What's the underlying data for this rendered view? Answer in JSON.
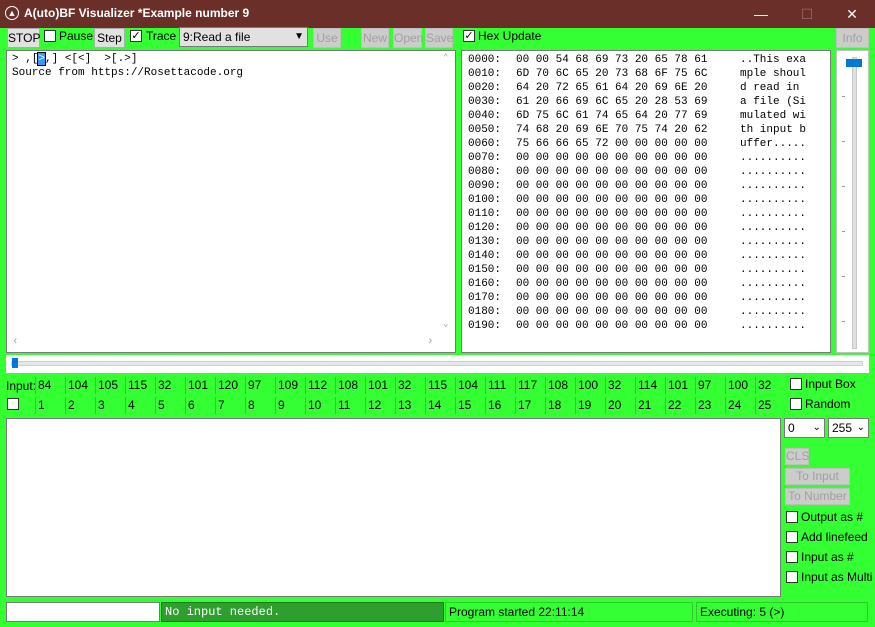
{
  "title": "A(uto)BF Visualizer *Example number 9",
  "window": {
    "minimize": "—",
    "maximize": "☐",
    "close": "✕"
  },
  "toolbar": {
    "stop": "STOP",
    "pause": "Pause",
    "step": "Step",
    "trace": "Trace",
    "example_selected": "9:Read a file",
    "use": "Use",
    "new": "New",
    "open": "Open",
    "save": "Save",
    "hex_update": "Hex Update",
    "info": "Info"
  },
  "code": {
    "line1_pre": "> ,[",
    "line1_cursor": ">",
    "line1_post": ",] <[<]  >[.>]",
    "line2": "Source from https://Rosettacode.org"
  },
  "hex_rows": [
    {
      "addr": "0000:",
      "bytes": "00 00 54 68 69 73 20 65 78 61",
      "ascii": "..This exa"
    },
    {
      "addr": "0010:",
      "bytes": "6D 70 6C 65 20 73 68 6F 75 6C",
      "ascii": "mple shoul"
    },
    {
      "addr": "0020:",
      "bytes": "64 20 72 65 61 64 20 69 6E 20",
      "ascii": "d read in "
    },
    {
      "addr": "0030:",
      "bytes": "61 20 66 69 6C 65 20 28 53 69",
      "ascii": "a file (Si"
    },
    {
      "addr": "0040:",
      "bytes": "6D 75 6C 61 74 65 64 20 77 69",
      "ascii": "mulated wi"
    },
    {
      "addr": "0050:",
      "bytes": "74 68 20 69 6E 70 75 74 20 62",
      "ascii": "th input b"
    },
    {
      "addr": "0060:",
      "bytes": "75 66 66 65 72 00 00 00 00 00",
      "ascii": "uffer....."
    },
    {
      "addr": "0070:",
      "bytes": "00 00 00 00 00 00 00 00 00 00",
      "ascii": ".........."
    },
    {
      "addr": "0080:",
      "bytes": "00 00 00 00 00 00 00 00 00 00",
      "ascii": ".........."
    },
    {
      "addr": "0090:",
      "bytes": "00 00 00 00 00 00 00 00 00 00",
      "ascii": ".........."
    },
    {
      "addr": "0100:",
      "bytes": "00 00 00 00 00 00 00 00 00 00",
      "ascii": ".........."
    },
    {
      "addr": "0110:",
      "bytes": "00 00 00 00 00 00 00 00 00 00",
      "ascii": ".........."
    },
    {
      "addr": "0120:",
      "bytes": "00 00 00 00 00 00 00 00 00 00",
      "ascii": ".........."
    },
    {
      "addr": "0130:",
      "bytes": "00 00 00 00 00 00 00 00 00 00",
      "ascii": ".........."
    },
    {
      "addr": "0140:",
      "bytes": "00 00 00 00 00 00 00 00 00 00",
      "ascii": ".........."
    },
    {
      "addr": "0150:",
      "bytes": "00 00 00 00 00 00 00 00 00 00",
      "ascii": ".........."
    },
    {
      "addr": "0160:",
      "bytes": "00 00 00 00 00 00 00 00 00 00",
      "ascii": ".........."
    },
    {
      "addr": "0170:",
      "bytes": "00 00 00 00 00 00 00 00 00 00",
      "ascii": ".........."
    },
    {
      "addr": "0180:",
      "bytes": "00 00 00 00 00 00 00 00 00 00",
      "ascii": ".........."
    },
    {
      "addr": "0190:",
      "bytes": "00 00 00 00 00 00 00 00 00 00",
      "ascii": ".........."
    }
  ],
  "input_row": {
    "label": "Input:",
    "values": [
      "84",
      "104",
      "105",
      "115",
      "32",
      "101",
      "120",
      "97",
      "109",
      "112",
      "108",
      "101",
      "32",
      "115",
      "104",
      "111",
      "117",
      "108",
      "100",
      "32",
      "114",
      "101",
      "97",
      "100",
      "32"
    ],
    "indices": [
      "1",
      "2",
      "3",
      "4",
      "5",
      "6",
      "7",
      "8",
      "9",
      "10",
      "11",
      "12",
      "13",
      "14",
      "15",
      "16",
      "17",
      "18",
      "19",
      "20",
      "21",
      "22",
      "23",
      "24",
      "25"
    ]
  },
  "right_options": {
    "input_box": "Input Box",
    "random": "Random",
    "range_min": "0",
    "range_max": "255",
    "cls": "CLS",
    "to_input": "To Input",
    "to_number": "To Number",
    "output_as_num": "Output as #",
    "add_linefeed": "Add linefeed",
    "input_as_num": "Input as #",
    "input_as_multi": "Input as Multi"
  },
  "status": {
    "input_field": "",
    "message": "No input needed.",
    "program": "Program started 22:11:14",
    "executing": "Executing: 5 (>)"
  },
  "colors": {
    "background": "#33ff33",
    "titlebar": "#6b2f2a",
    "status_dark": "#2e9e2e"
  }
}
